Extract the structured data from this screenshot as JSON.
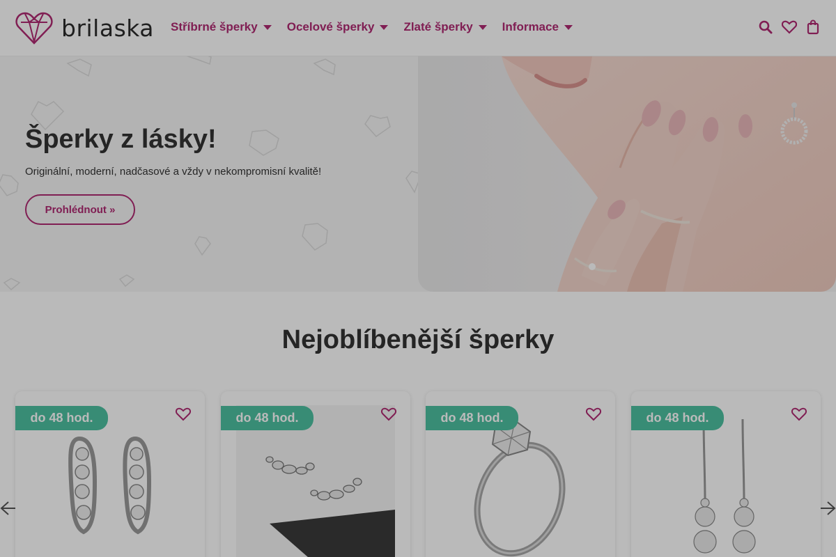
{
  "header": {
    "logo_text": "brilaska",
    "nav": [
      {
        "label": "Stříbrné šperky"
      },
      {
        "label": "Ocelové šperky"
      },
      {
        "label": "Zlaté šperky"
      },
      {
        "label": "Informace"
      }
    ],
    "icons": [
      "search-icon",
      "heart-icon",
      "shopping-bag-icon"
    ]
  },
  "hero": {
    "title": "Šperky z lásky!",
    "subtitle": "Originální, moderní, nadčasové a vždy v nekompromisní kvalitě!",
    "button_label": "Prohlédnout »"
  },
  "section": {
    "title": "Nejoblíbenější šperky"
  },
  "products": [
    {
      "badge": "do 48 hod.",
      "image": "silver-hoop-earrings"
    },
    {
      "badge": "do 48 hod.",
      "image": "ear-climber-earrings"
    },
    {
      "badge": "do 48 hod.",
      "image": "solitaire-ring"
    },
    {
      "badge": "do 48 hod.",
      "image": "drop-earrings"
    }
  ],
  "colors": {
    "brand": "#b02a72",
    "badge": "#4ec1a1",
    "text": "#333333"
  }
}
